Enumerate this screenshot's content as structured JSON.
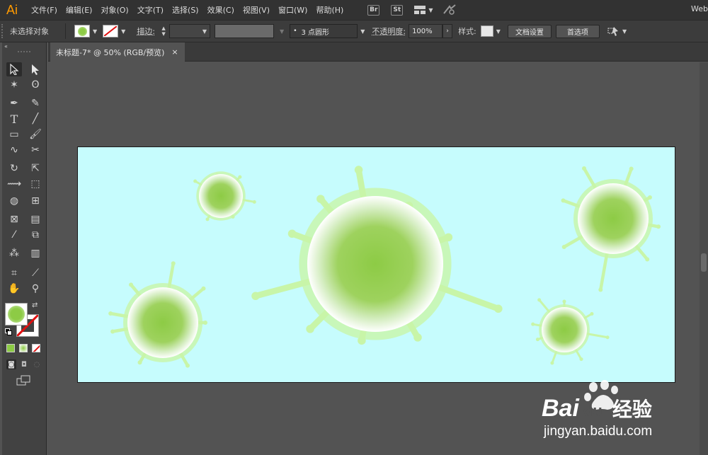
{
  "app": {
    "logo": "Ai",
    "logo_color": "#ff9a00"
  },
  "menu": [
    "文件(F)",
    "编辑(E)",
    "对象(O)",
    "文字(T)",
    "选择(S)",
    "效果(C)",
    "视图(V)",
    "窗口(W)",
    "帮助(H)"
  ],
  "menubar_icons": {
    "bridge": "Br",
    "stock": "St"
  },
  "workspace": {
    "label": "Web"
  },
  "control_bar": {
    "selection_status": "未选择对象",
    "stroke_label": "描边:",
    "brush_value": "3 点圆形",
    "opacity_label": "不透明度:",
    "opacity_value": "100%",
    "style_label": "样式:",
    "doc_setup_label": "文档设置",
    "preferences_label": "首选项"
  },
  "document_tab": {
    "title": "未标题-7* @ 50% (RGB/预览)",
    "close": "×"
  },
  "colors": {
    "artboard_bg": "#c6fcfd",
    "fill_color": "#8dcb45",
    "splash_color": "#c8f5a8",
    "accent": "#ff9a00"
  },
  "toolbar_icons": [
    "selection-tool-icon",
    "direct-selection-tool-icon",
    "magic-wand-icon",
    "lasso-icon",
    "pen-tool-icon",
    "curvature-tool-icon",
    "type-tool-icon",
    "line-tool-icon",
    "rectangle-tool-icon",
    "paintbrush-icon",
    "shaper-tool-icon",
    "scissors-icon",
    "rotate-tool-icon",
    "scale-tool-icon",
    "width-tool-icon",
    "free-transform-icon",
    "shape-builder-icon",
    "perspective-grid-icon",
    "mesh-tool-icon",
    "gradient-tool-icon",
    "eyedropper-icon",
    "blend-tool-icon",
    "symbol-sprayer-icon",
    "column-graph-icon",
    "artboard-tool-icon",
    "slice-tool-icon",
    "hand-tool-icon",
    "zoom-tool-icon"
  ],
  "watermark": {
    "brand": "Bai",
    "brand_suffix": "经验",
    "url": "jingyan.baidu.com",
    "du": "du"
  }
}
